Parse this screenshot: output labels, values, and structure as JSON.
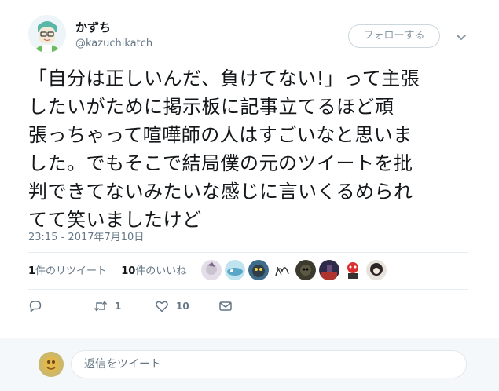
{
  "user": {
    "name": "かずち",
    "handle": "@kazuchikatch"
  },
  "follow_button": {
    "label": "フォローする"
  },
  "tweet": {
    "lines": [
      "「自分は正しいんだ、負けてない!」って主張",
      "したいがために掲示板に記事立てるほど頑",
      "張っちゃって喧嘩師の人はすごいなと思いま",
      "した。でもそこで結局僕の元のツイートを批",
      "判できてないみたいな感じに言いくるめられ",
      "てて笑いましたけど"
    ],
    "timestamp": "23:15 - 2017年7月10日"
  },
  "stats": {
    "retweet_count": "1",
    "retweet_label": "件のリツイート",
    "like_count": "10",
    "like_label": "件のいいね"
  },
  "actions": {
    "reply_count": "",
    "retweet_count": "1",
    "like_count": "10"
  },
  "likers": [
    {
      "icon": "liker-avatar-1",
      "color": "#c9c2cf"
    },
    {
      "icon": "liker-avatar-2",
      "color": "#5aa6c9"
    },
    {
      "icon": "liker-avatar-3",
      "color": "#2f3e47"
    },
    {
      "icon": "liker-avatar-4",
      "color": "#e8e8e8"
    },
    {
      "icon": "liker-avatar-5",
      "color": "#3b3a2d"
    },
    {
      "icon": "liker-avatar-6",
      "color": "#6a4d7a"
    },
    {
      "icon": "liker-avatar-7",
      "color": "#d9302f"
    },
    {
      "icon": "liker-avatar-8",
      "color": "#2b2523"
    }
  ],
  "reply": {
    "placeholder": "返信をツイート"
  },
  "colors": {
    "text": "#14171a",
    "secondary": "#657786",
    "border": "#e6ecf0",
    "background_bar": "#f5f8fa"
  }
}
